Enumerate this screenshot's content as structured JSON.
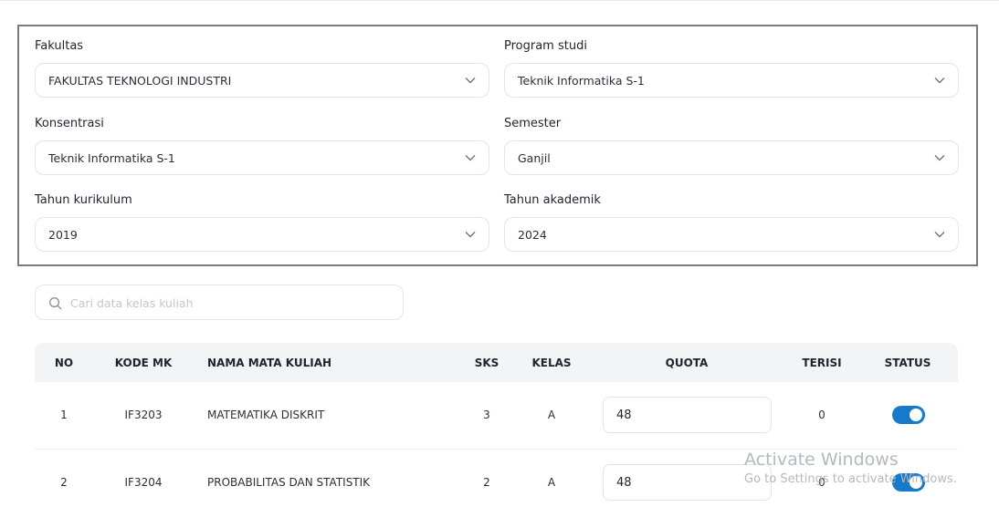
{
  "filters": {
    "fakultas": {
      "label": "Fakultas",
      "value": "FAKULTAS TEKNOLOGI INDUSTRI"
    },
    "program_studi": {
      "label": "Program studi",
      "value": "Teknik Informatika S-1"
    },
    "konsentrasi": {
      "label": "Konsentrasi",
      "value": "Teknik Informatika S-1"
    },
    "semester": {
      "label": "Semester",
      "value": "Ganjil"
    },
    "tahun_kurikulum": {
      "label": "Tahun kurikulum",
      "value": "2019"
    },
    "tahun_akademik": {
      "label": "Tahun akademik",
      "value": "2024"
    }
  },
  "search": {
    "placeholder": "Cari data kelas kuliah",
    "value": ""
  },
  "table": {
    "headers": {
      "no": "NO",
      "kode_mk": "KODE MK",
      "nama": "NAMA MATA KULIAH",
      "sks": "SKS",
      "kelas": "KELAS",
      "quota": "QUOTA",
      "terisi": "TERISI",
      "status": "STATUS"
    },
    "rows": [
      {
        "no": "1",
        "kode_mk": "IF3203",
        "nama": "MATEMATIKA DISKRIT",
        "sks": "3",
        "kelas": "A",
        "quota": "48",
        "terisi": "0",
        "status": true
      },
      {
        "no": "2",
        "kode_mk": "IF3204",
        "nama": "PROBABILITAS DAN STATISTIK",
        "sks": "2",
        "kelas": "A",
        "quota": "48",
        "terisi": "0",
        "status": true
      }
    ]
  },
  "watermark": {
    "title": "Activate Windows",
    "subtitle": "Go to Settings to activate Windows."
  },
  "colors": {
    "accent": "#1679c9",
    "panel_border": "#7a7a7a",
    "header_bg": "#f3f4f6"
  },
  "icons": {
    "select": "chevron-down-icon",
    "search": "search-icon"
  }
}
